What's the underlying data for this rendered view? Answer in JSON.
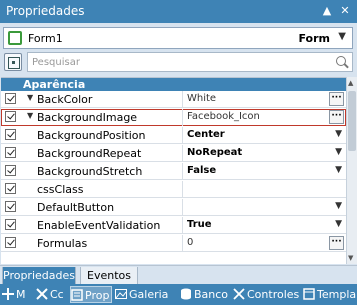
{
  "window": {
    "title": "Propriedades",
    "buttons": [
      "pin-icon",
      "close-icon"
    ]
  },
  "object_selector": {
    "name": "Form1",
    "type": "Form"
  },
  "search": {
    "placeholder": "Pesquisar"
  },
  "grid": {
    "category": "Aparência",
    "rows": [
      {
        "name": "BackColor",
        "value": "White",
        "expandable": true,
        "editor": "ellipsis"
      },
      {
        "name": "BackgroundImage",
        "value": "Facebook_Icon",
        "expandable": true,
        "editor": "ellipsis",
        "highlighted": true
      },
      {
        "name": "BackgroundPosition",
        "value": "Center",
        "editor": "dropdown"
      },
      {
        "name": "BackgroundRepeat",
        "value": "NoRepeat",
        "editor": "dropdown"
      },
      {
        "name": "BackgroundStretch",
        "value": "False",
        "editor": "dropdown"
      },
      {
        "name": "cssClass",
        "value": ""
      },
      {
        "name": "DefaultButton",
        "value": "",
        "editor": "dropdown"
      },
      {
        "name": "EnableEventValidation",
        "value": "True",
        "editor": "dropdown",
        "bold": true
      },
      {
        "name": "Formulas",
        "value": "0",
        "editor": "ellipsis"
      }
    ]
  },
  "tabs": [
    {
      "label": "Propriedades",
      "active": true
    },
    {
      "label": "Eventos",
      "active": false
    }
  ],
  "toolbar": [
    {
      "label": "M",
      "icon": "move-icon"
    },
    {
      "label": "Cc",
      "icon": "tools-icon"
    },
    {
      "label": "Prop",
      "icon": "properties-icon",
      "selected": true
    },
    {
      "label": "Galeria",
      "icon": "gallery-icon"
    },
    {
      "label": "Banco",
      "icon": "database-icon"
    },
    {
      "label": "Controles",
      "icon": "controls-icon"
    },
    {
      "label": "Templa",
      "icon": "template-icon"
    }
  ],
  "colors": {
    "accent": "#3e83b5",
    "panel": "#d7e3ef",
    "highlight_border": "#c0392b"
  }
}
